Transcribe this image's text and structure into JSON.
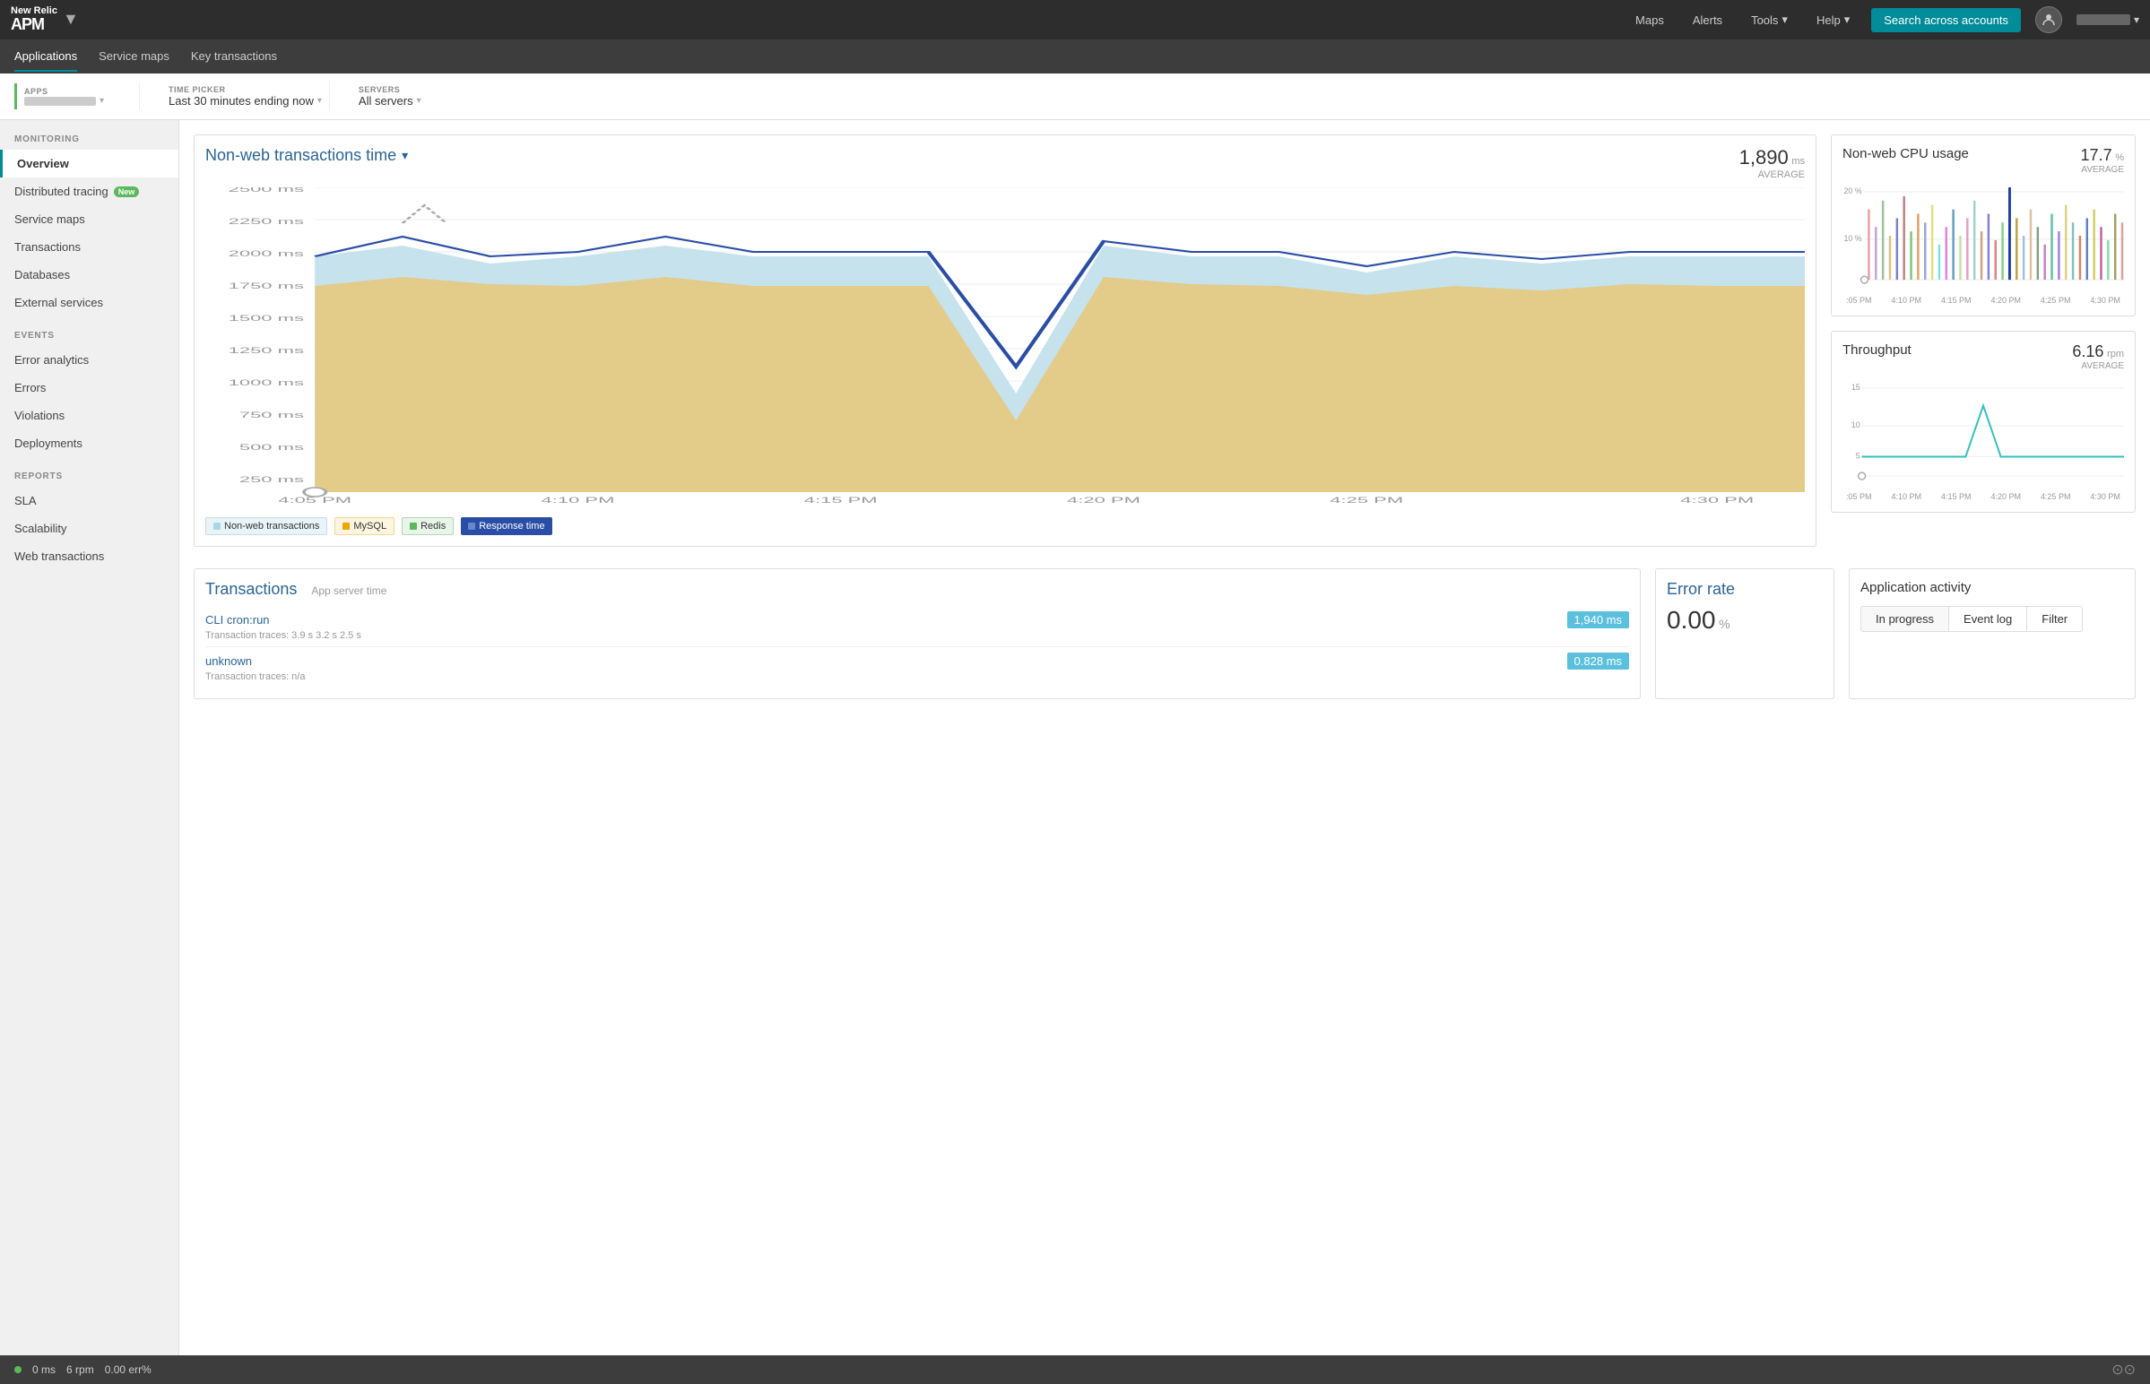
{
  "app": {
    "name": "New Relic",
    "product": "APM"
  },
  "topnav": {
    "maps_label": "Maps",
    "alerts_label": "Alerts",
    "tools_label": "Tools",
    "help_label": "Help",
    "search_label": "Search across accounts"
  },
  "subnav": {
    "items": [
      {
        "id": "applications",
        "label": "Applications"
      },
      {
        "id": "service-maps",
        "label": "Service maps"
      },
      {
        "id": "key-transactions",
        "label": "Key transactions"
      }
    ]
  },
  "filters": {
    "apps_label": "APPS",
    "apps_value": "··········",
    "time_label": "TIME PICKER",
    "time_value": "Last 30 minutes ending now",
    "servers_label": "SERVERS",
    "servers_value": "All servers"
  },
  "sidebar": {
    "monitoring_label": "MONITORING",
    "monitoring_items": [
      {
        "id": "overview",
        "label": "Overview",
        "active": true
      },
      {
        "id": "distributed-tracing",
        "label": "Distributed tracing",
        "badge": "New"
      },
      {
        "id": "service-maps",
        "label": "Service maps"
      },
      {
        "id": "transactions",
        "label": "Transactions"
      },
      {
        "id": "databases",
        "label": "Databases"
      },
      {
        "id": "external-services",
        "label": "External services"
      }
    ],
    "events_label": "EVENTS",
    "events_items": [
      {
        "id": "error-analytics",
        "label": "Error analytics"
      },
      {
        "id": "errors",
        "label": "Errors"
      },
      {
        "id": "violations",
        "label": "Violations"
      },
      {
        "id": "deployments",
        "label": "Deployments"
      }
    ],
    "reports_label": "REPORTS",
    "reports_items": [
      {
        "id": "sla",
        "label": "SLA"
      },
      {
        "id": "scalability",
        "label": "Scalability"
      },
      {
        "id": "web-transactions",
        "label": "Web transactions"
      }
    ]
  },
  "main_chart": {
    "title": "Non-web transactions time",
    "avg_value": "1,890",
    "avg_unit": "ms",
    "avg_label": "AVERAGE",
    "y_labels": [
      "2500 ms",
      "2250 ms",
      "2000 ms",
      "1750 ms",
      "1500 ms",
      "1250 ms",
      "1000 ms",
      "750 ms",
      "500 ms",
      "250 ms"
    ],
    "x_labels": [
      "4:05 PM",
      "4:10 PM",
      "4:15 PM",
      "4:20 PM",
      "4:25 PM",
      "4:30 PM"
    ],
    "legend": [
      {
        "id": "non-web",
        "label": "Non-web transactions",
        "color": "#a8d8e8",
        "text_color": "#555"
      },
      {
        "id": "mysql",
        "label": "MySQL",
        "color": "#f0a500",
        "text_color": "#555"
      },
      {
        "id": "redis",
        "label": "Redis",
        "color": "#5cb85c",
        "text_color": "#555"
      },
      {
        "id": "response-time",
        "label": "Response time",
        "color": "#2a4ea6",
        "text_color": "white"
      }
    ]
  },
  "cpu_chart": {
    "title": "Non-web CPU usage",
    "avg_value": "17.7",
    "avg_unit": "%",
    "avg_label": "AVERAGE",
    "y_labels": [
      "20 %",
      "10 %"
    ],
    "x_labels": [
      ":05 PM",
      "4:10 PM",
      "4:15 PM",
      "4:20 PM",
      "4:25 PM",
      "4:30 PM"
    ]
  },
  "throughput_chart": {
    "title": "Throughput",
    "avg_value": "6.16",
    "avg_unit": "rpm",
    "avg_label": "AVERAGE",
    "y_labels": [
      "15",
      "10",
      "5"
    ],
    "x_labels": [
      ":05 PM",
      "4:10 PM",
      "4:15 PM",
      "4:20 PM",
      "4:25 PM",
      "4:30 PM"
    ]
  },
  "transactions": {
    "title": "Transactions",
    "subtitle": "App server time",
    "rows": [
      {
        "name": "CLI cron:run",
        "time": "1,940 ms",
        "traces": "Transaction traces:  3.9 s   3.2 s   2.5 s"
      },
      {
        "name": "unknown",
        "time": "0.828 ms",
        "traces": "Transaction traces:  n/a"
      }
    ]
  },
  "error_rate": {
    "title": "Error rate",
    "value": "0.00",
    "unit": "%"
  },
  "activity": {
    "title": "Application activity",
    "buttons": [
      "In progress",
      "Event log",
      "Filter"
    ]
  },
  "status_bar": {
    "ms_label": "0 ms",
    "rpm_label": "6 rpm",
    "err_label": "0.00 err%"
  }
}
